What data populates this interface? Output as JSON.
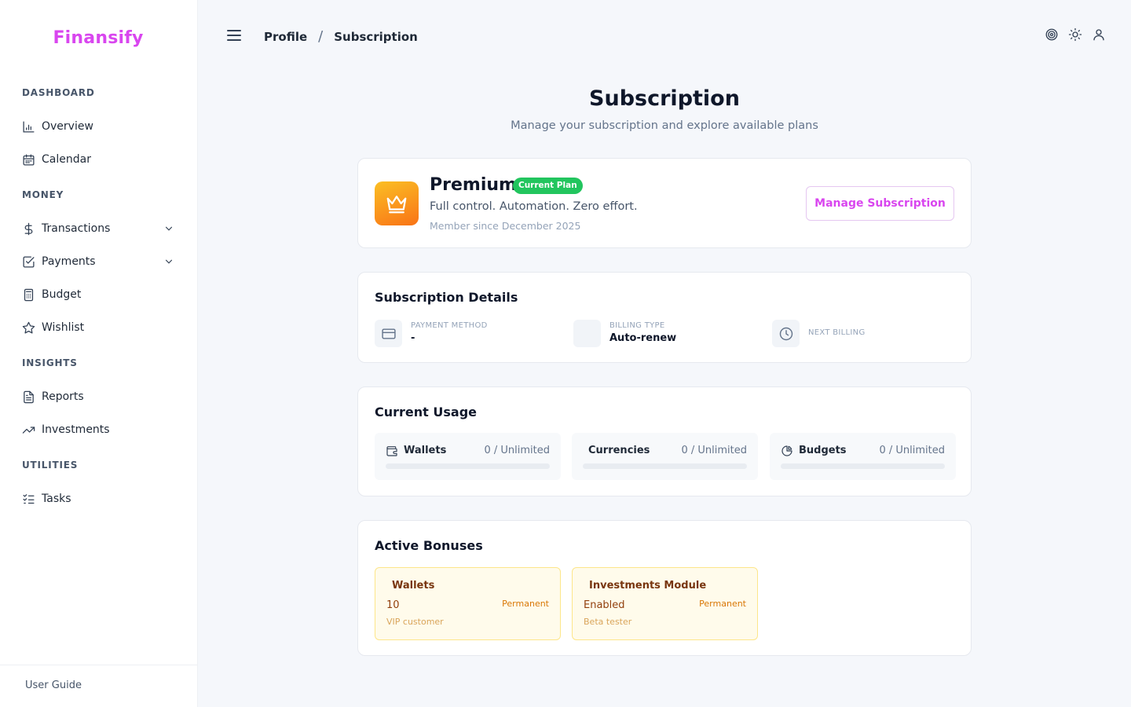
{
  "app": {
    "name": "Finansify",
    "accent": "#d946ef"
  },
  "sidebar": {
    "sections": [
      {
        "title": "DASHBOARD"
      },
      {
        "title": "MONEY"
      },
      {
        "title": "INSIGHTS"
      },
      {
        "title": "UTILITIES"
      }
    ],
    "items": [
      {
        "label": "Overview",
        "icon": "bar-chart-icon"
      },
      {
        "label": "Calendar",
        "icon": "calendar-icon"
      },
      {
        "label": "Transactions",
        "icon": "dollar-icon",
        "expandable": true
      },
      {
        "label": "Payments",
        "icon": "check-square-icon",
        "expandable": true
      },
      {
        "label": "Budget",
        "icon": "calculator-icon"
      },
      {
        "label": "Wishlist",
        "icon": "star-icon"
      },
      {
        "label": "Reports",
        "icon": "document-icon"
      },
      {
        "label": "Investments",
        "icon": "trending-up-icon"
      },
      {
        "label": "Tasks",
        "icon": "checklist-icon"
      }
    ],
    "footer": {
      "label": "User Guide"
    }
  },
  "header": {
    "breadcrumb": [
      "Profile",
      "Subscription"
    ],
    "breadcrumb_separator": "/",
    "icons": [
      "target-icon",
      "sun-icon",
      "user-icon"
    ]
  },
  "page": {
    "title": "Subscription",
    "subtitle": "Manage your subscription and explore available plans"
  },
  "plan": {
    "name": "Premium",
    "badge": "Current Plan",
    "tagline": "Full control. Automation. Zero effort.",
    "since": "Member since December 2025",
    "manage_label": "Manage Subscription",
    "icon": "crown-icon"
  },
  "details": {
    "title": "Subscription Details",
    "payment_method": {
      "label": "PAYMENT METHOD",
      "value": "-"
    },
    "billing_type": {
      "label": "BILLING TYPE",
      "value": "Auto-renew"
    },
    "next_billing": {
      "label": "NEXT BILLING",
      "value": ""
    }
  },
  "usage": {
    "title": "Current Usage",
    "items": [
      {
        "name": "Wallets",
        "count": "0 / Unlimited",
        "fill_fraction": 0,
        "icon": "wallet-icon"
      },
      {
        "name": "Currencies",
        "count": "0 / Unlimited",
        "fill_fraction": 0,
        "icon": ""
      },
      {
        "name": "Budgets",
        "count": "0 / Unlimited",
        "fill_fraction": 0,
        "icon": "pie-chart-icon"
      }
    ]
  },
  "bonuses": {
    "title": "Active Bonuses",
    "items": [
      {
        "name": "Wallets",
        "value": "10",
        "duration": "Permanent",
        "reason": "VIP customer"
      },
      {
        "name": "Investments Module",
        "value": "Enabled",
        "duration": "Permanent",
        "reason": "Beta tester"
      }
    ]
  }
}
